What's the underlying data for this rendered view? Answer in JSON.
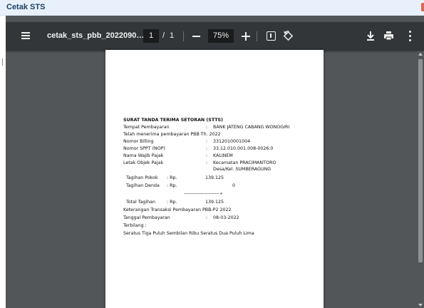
{
  "window": {
    "title": "Cetak STS"
  },
  "toolbar": {
    "filename": "cetak_sts_pbb_2022090…",
    "page_current": "1",
    "page_separator": "/",
    "page_total": "1",
    "zoom": "75%",
    "icons": [
      "menu-icon",
      "zoom-out-icon",
      "zoom-in-icon",
      "fit-page-icon",
      "rotate-icon",
      "download-icon",
      "print-icon",
      "more-icon"
    ]
  },
  "document": {
    "heading": "SURAT TANDA TERIMA SETORAN (STTS)",
    "rows": [
      {
        "label": "Tempat Pembayaran",
        "sep": ":",
        "value": "BANK JATENG CABANG WONOGIRI"
      },
      {
        "label": "Telah menerima pembayaran PBB Th. 2022"
      },
      {
        "label": "Nomor Billing",
        "sep": ":",
        "value": "3312010001004"
      },
      {
        "label": "Nomor SPPT (NOP)",
        "sep": ":",
        "value": "33.12.010.001.008-0026.0"
      },
      {
        "label": "Nama Wajib Pajak",
        "sep": ":",
        "value": "KALINEM"
      },
      {
        "label": "Letak Objek Pajak",
        "sep": ":",
        "value": "Kecamatan PRACIMANTORO",
        "value2": "Desa/Kel. SUMBERAGUNG"
      }
    ],
    "amounts": [
      {
        "label": "Tagihan Pokok",
        "currency": ": Rp.",
        "value": "139.125"
      },
      {
        "label": "Tagihan Denda",
        "currency": ": Rp.",
        "value": "0"
      }
    ],
    "sum_line": "-----------------------------------  +",
    "total": {
      "label": "Total Tagihan",
      "currency": ": Rp.",
      "value": "139.125"
    },
    "keterangan": "Keterangan Transaksi Pembayaran PBB-P2 2022",
    "tanggal": {
      "label": "Tanggal Pembayaran",
      "sep": ":",
      "value": "08-03-2022"
    },
    "terbilang_label": "Terbilang :",
    "terbilang_value": "Seratus Tiga Puluh Sembilan Ribu Seratus Dua Puluh Lima"
  },
  "colors": {
    "toolbar": "#323639",
    "viewer_bg": "#525659",
    "titlebar": "#e8f1fb",
    "title_text": "#1d3f66"
  }
}
